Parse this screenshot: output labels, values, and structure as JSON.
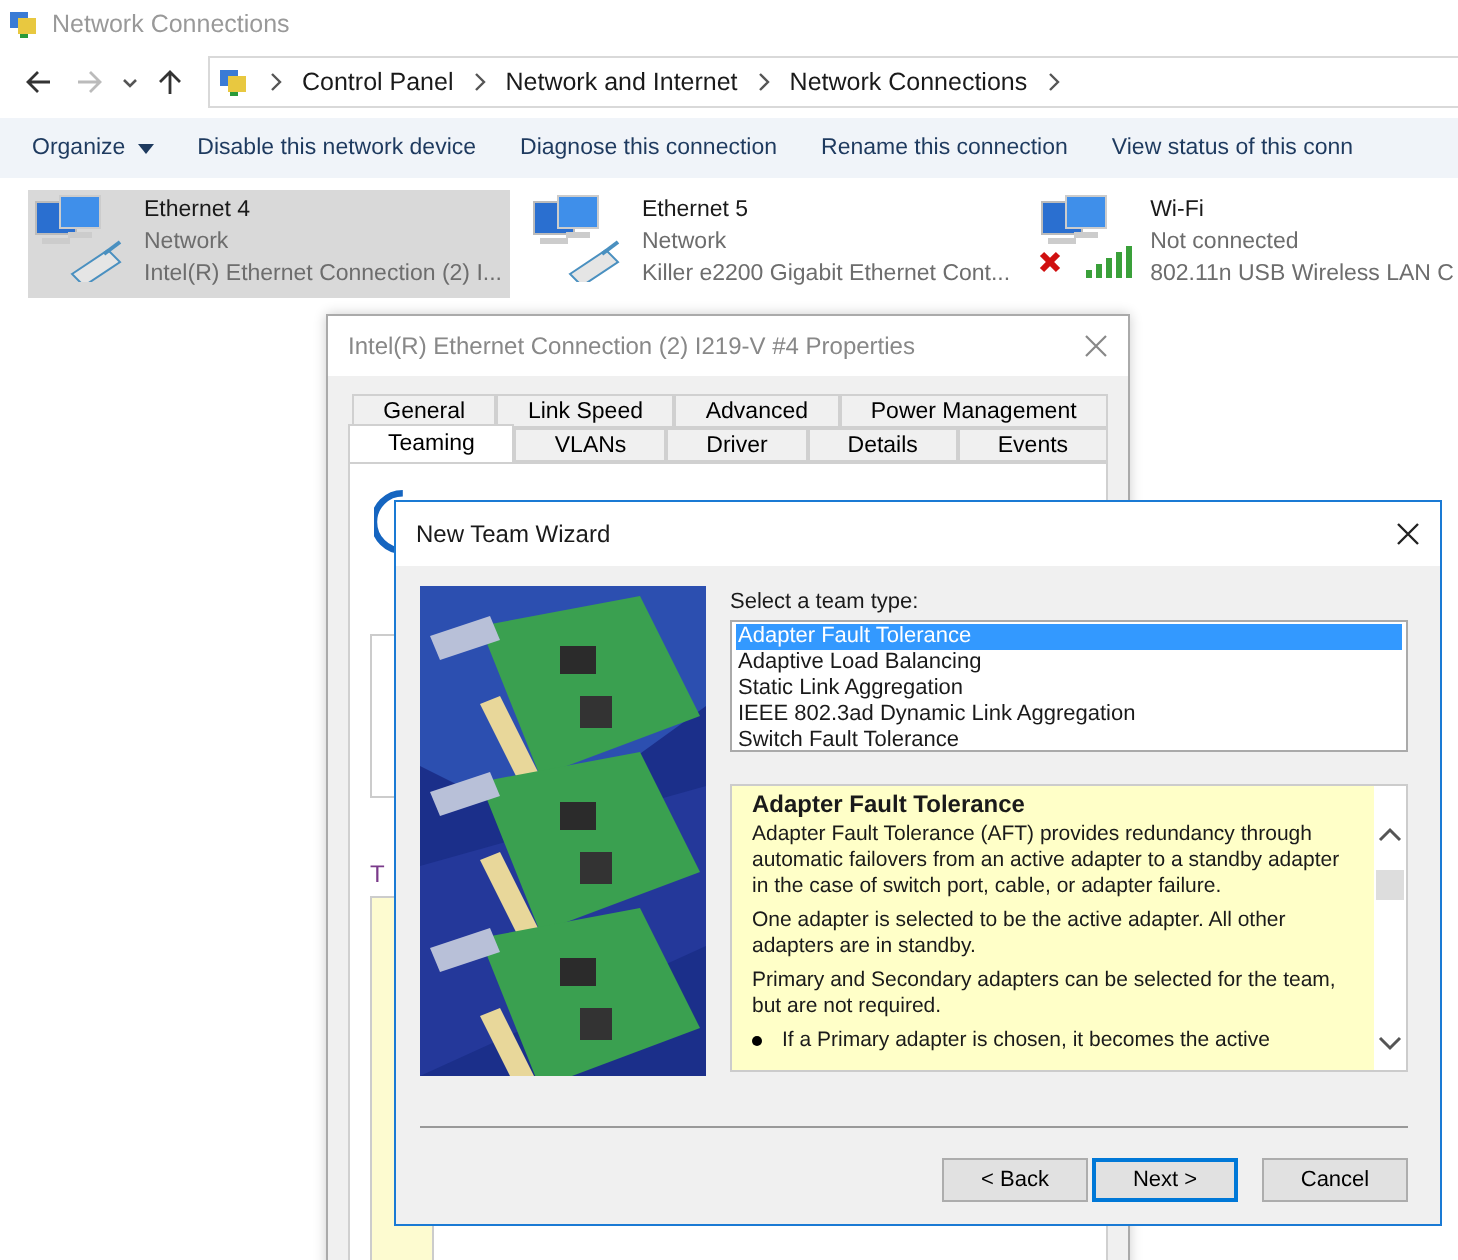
{
  "window": {
    "title": "Network Connections"
  },
  "address_bar": {
    "crumbs": [
      "Control Panel",
      "Network and Internet",
      "Network Connections"
    ]
  },
  "toolbar": {
    "organize": "Organize",
    "commands": [
      "Disable this network device",
      "Diagnose this connection",
      "Rename this connection",
      "View status of this conn"
    ]
  },
  "connections": [
    {
      "kind": "ethernet",
      "name": "Ethernet 4",
      "status": "Network",
      "device": "Intel(R) Ethernet Connection (2) I...",
      "selected": true
    },
    {
      "kind": "ethernet",
      "name": "Ethernet 5",
      "status": "Network",
      "device": "Killer e2200 Gigabit Ethernet Cont...",
      "selected": false
    },
    {
      "kind": "wifi",
      "name": "Wi-Fi",
      "status": "Not connected",
      "device": "802.11n USB Wireless LAN C",
      "selected": false
    }
  ],
  "properties_dialog": {
    "title": "Intel(R) Ethernet Connection (2) I219-V #4 Properties",
    "tab_rows": [
      [
        {
          "label": "General",
          "selected": false
        },
        {
          "label": "Link Speed",
          "selected": false
        },
        {
          "label": "Advanced",
          "selected": false
        },
        {
          "label": "Power Management",
          "selected": false
        }
      ],
      [
        {
          "label": "Teaming",
          "selected": true
        },
        {
          "label": "VLANs",
          "selected": false
        },
        {
          "label": "Driver",
          "selected": false
        },
        {
          "label": "Details",
          "selected": false
        },
        {
          "label": "Events",
          "selected": false
        }
      ]
    ],
    "section_letter": "T"
  },
  "wizard": {
    "title": "New Team Wizard",
    "select_label": "Select a team type:",
    "team_types": [
      {
        "label": "Adapter Fault Tolerance",
        "selected": true
      },
      {
        "label": "Adaptive Load Balancing",
        "selected": false
      },
      {
        "label": "Static Link Aggregation",
        "selected": false
      },
      {
        "label": "IEEE 802.3ad Dynamic Link Aggregation",
        "selected": false
      },
      {
        "label": "Switch Fault Tolerance",
        "selected": false
      }
    ],
    "description": {
      "heading": "Adapter Fault Tolerance",
      "paragraphs": [
        "Adapter Fault Tolerance (AFT) provides redundancy through automatic failovers from an active adapter to a standby adapter in the case of switch port, cable, or adapter failure.",
        "One adapter is selected to be the active adapter. All other adapters are in standby.",
        "Primary and Secondary adapters can be selected for the team, but are not required."
      ],
      "bullets": [
        "If a Primary adapter is chosen, it becomes the active"
      ]
    },
    "buttons": [
      {
        "label": "< Back",
        "default": false
      },
      {
        "label": "Next >",
        "default": true
      },
      {
        "label": "Cancel",
        "default": false
      }
    ]
  }
}
